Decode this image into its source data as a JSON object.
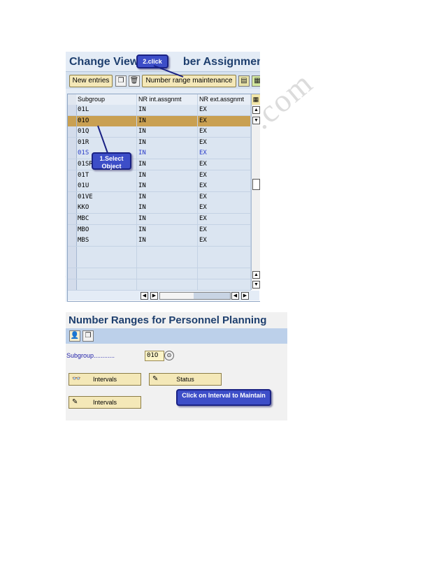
{
  "window": {
    "title": "Change View \"Number Assignment\": Overview",
    "title_visible": "Change View \"N",
    "title_visible_tail": "ber Assignment\": C"
  },
  "toolbar": {
    "new_entries_label": "New entries",
    "number_range_maintenance_label": "Number range maintenance"
  },
  "table": {
    "columns": [
      "Subgroup",
      "NR int.assgnmt",
      "NR ext.assgnmt"
    ],
    "rows": [
      {
        "subgroup": "01L",
        "nr_int": "IN",
        "nr_ext": "EX"
      },
      {
        "subgroup": "01O",
        "nr_int": "IN",
        "nr_ext": "EX",
        "selected": true
      },
      {
        "subgroup": "01Q",
        "nr_int": "IN",
        "nr_ext": "EX"
      },
      {
        "subgroup": "01R",
        "nr_int": "IN",
        "nr_ext": "EX"
      },
      {
        "subgroup": "01S",
        "nr_int": "IN",
        "nr_ext": "EX"
      },
      {
        "subgroup": "01SR",
        "nr_int": "IN",
        "nr_ext": "EX"
      },
      {
        "subgroup": "01T",
        "nr_int": "IN",
        "nr_ext": "EX"
      },
      {
        "subgroup": "01U",
        "nr_int": "IN",
        "nr_ext": "EX"
      },
      {
        "subgroup": "01VE",
        "nr_int": "IN",
        "nr_ext": "EX"
      },
      {
        "subgroup": "KKO",
        "nr_int": "IN",
        "nr_ext": "EX"
      },
      {
        "subgroup": "MBC",
        "nr_int": "IN",
        "nr_ext": "EX"
      },
      {
        "subgroup": "MBO",
        "nr_int": "IN",
        "nr_ext": "EX"
      },
      {
        "subgroup": "MBS",
        "nr_int": "IN",
        "nr_ext": "EX"
      }
    ],
    "empty_rows": 4
  },
  "callouts": {
    "click": "2.click",
    "select_object_line1": "1.Select",
    "select_object_line2": "Object",
    "click_interval": "Click on Interval to Maintain"
  },
  "panel2": {
    "title": "Number Ranges for Personnel Planning",
    "subgroup_label": "Subgroup............",
    "subgroup_value": "01O",
    "buttons": {
      "intervals_display": "Intervals",
      "status": "Status",
      "intervals_change": "Intervals"
    }
  },
  "watermark": "www.sap-topjobs.com",
  "colors": {
    "title_blue": "#1e3f6e",
    "selection_row": "#c9a052",
    "callout_blue": "#3d4ec8",
    "row_blue_text": "#2a3cc8"
  }
}
